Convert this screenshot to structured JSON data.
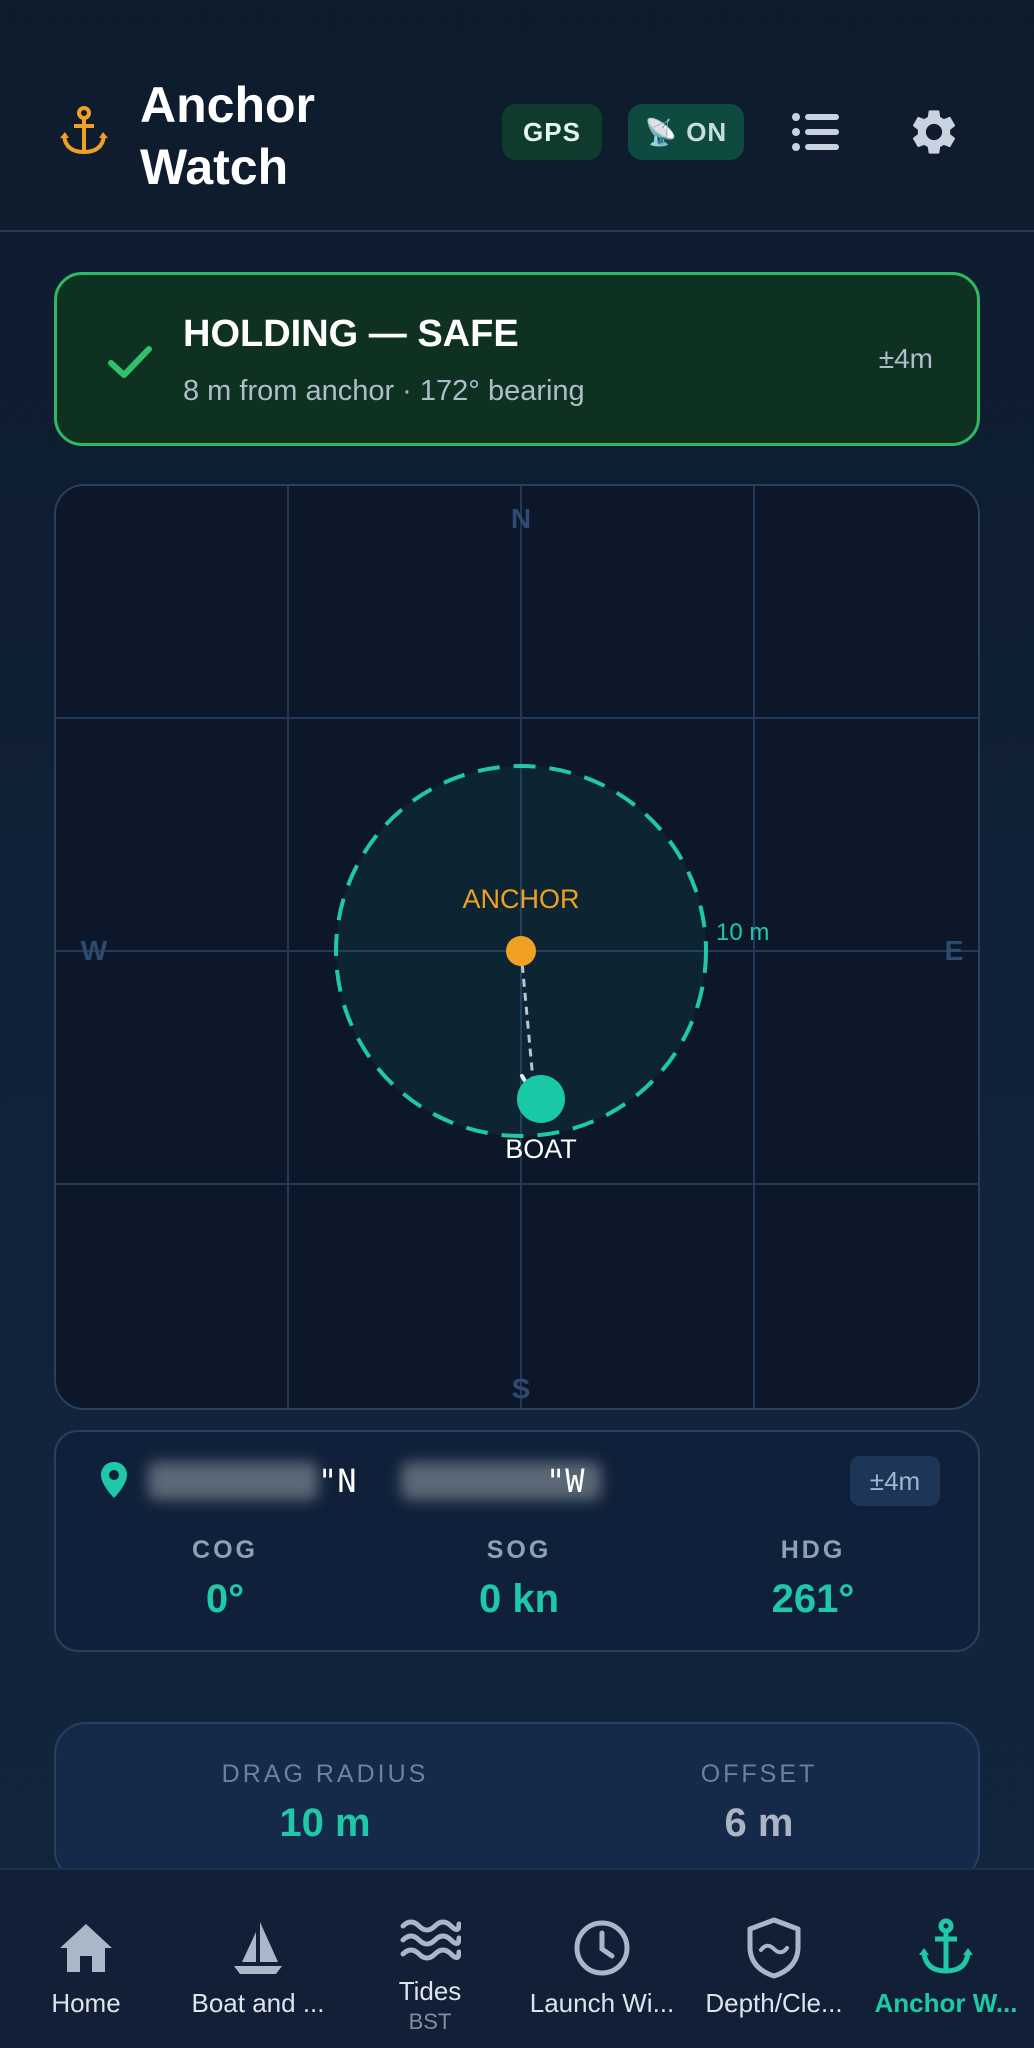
{
  "header": {
    "title": "Anchor Watch",
    "gps_badge": "GPS",
    "alarm_badge": "ON"
  },
  "status": {
    "title": "HOLDING — SAFE",
    "subtitle": "8 m from anchor · 172° bearing",
    "accuracy": "±4m"
  },
  "map": {
    "north": "N",
    "south": "S",
    "east": "E",
    "west": "W",
    "anchor_label": "ANCHOR",
    "boat_label": "BOAT",
    "radius_label": "10 m"
  },
  "position": {
    "lat_suffix": "\"N",
    "lon_suffix": "\"W",
    "accuracy": "±4m",
    "metrics": [
      {
        "label": "COG",
        "value": "0°"
      },
      {
        "label": "SOG",
        "value": "0 kn"
      },
      {
        "label": "HDG",
        "value": "261°"
      }
    ]
  },
  "drag": {
    "radius_label": "DRAG RADIUS",
    "radius_value": "10 m",
    "offset_label": "OFFSET",
    "offset_value": "6 m"
  },
  "nav": {
    "items": [
      {
        "label": "Home",
        "icon": "home-icon"
      },
      {
        "label": "Boat and ...",
        "icon": "sailboat-icon"
      },
      {
        "label": "Tides",
        "sub": "BST",
        "icon": "waves-icon"
      },
      {
        "label": "Launch Wi...",
        "icon": "clock-icon"
      },
      {
        "label": "Depth/Cle...",
        "icon": "shield-wave-icon"
      },
      {
        "label": "Anchor W...",
        "icon": "anchor-icon",
        "active": true
      }
    ]
  },
  "colors": {
    "accent": "#1fc9a8",
    "anchor": "#f0a022",
    "safe": "#2fb864"
  }
}
